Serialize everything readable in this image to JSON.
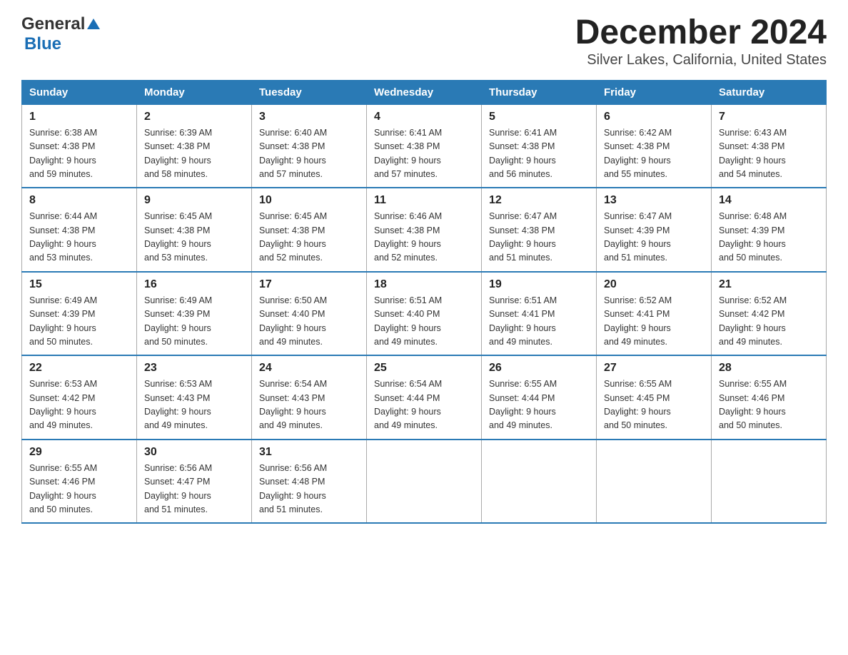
{
  "logo": {
    "general": "General",
    "blue": "Blue"
  },
  "title": "December 2024",
  "subtitle": "Silver Lakes, California, United States",
  "headers": [
    "Sunday",
    "Monday",
    "Tuesday",
    "Wednesday",
    "Thursday",
    "Friday",
    "Saturday"
  ],
  "weeks": [
    [
      {
        "day": "1",
        "sunrise": "6:38 AM",
        "sunset": "4:38 PM",
        "daylight": "9 hours and 59 minutes."
      },
      {
        "day": "2",
        "sunrise": "6:39 AM",
        "sunset": "4:38 PM",
        "daylight": "9 hours and 58 minutes."
      },
      {
        "day": "3",
        "sunrise": "6:40 AM",
        "sunset": "4:38 PM",
        "daylight": "9 hours and 57 minutes."
      },
      {
        "day": "4",
        "sunrise": "6:41 AM",
        "sunset": "4:38 PM",
        "daylight": "9 hours and 57 minutes."
      },
      {
        "day": "5",
        "sunrise": "6:41 AM",
        "sunset": "4:38 PM",
        "daylight": "9 hours and 56 minutes."
      },
      {
        "day": "6",
        "sunrise": "6:42 AM",
        "sunset": "4:38 PM",
        "daylight": "9 hours and 55 minutes."
      },
      {
        "day": "7",
        "sunrise": "6:43 AM",
        "sunset": "4:38 PM",
        "daylight": "9 hours and 54 minutes."
      }
    ],
    [
      {
        "day": "8",
        "sunrise": "6:44 AM",
        "sunset": "4:38 PM",
        "daylight": "9 hours and 53 minutes."
      },
      {
        "day": "9",
        "sunrise": "6:45 AM",
        "sunset": "4:38 PM",
        "daylight": "9 hours and 53 minutes."
      },
      {
        "day": "10",
        "sunrise": "6:45 AM",
        "sunset": "4:38 PM",
        "daylight": "9 hours and 52 minutes."
      },
      {
        "day": "11",
        "sunrise": "6:46 AM",
        "sunset": "4:38 PM",
        "daylight": "9 hours and 52 minutes."
      },
      {
        "day": "12",
        "sunrise": "6:47 AM",
        "sunset": "4:38 PM",
        "daylight": "9 hours and 51 minutes."
      },
      {
        "day": "13",
        "sunrise": "6:47 AM",
        "sunset": "4:39 PM",
        "daylight": "9 hours and 51 minutes."
      },
      {
        "day": "14",
        "sunrise": "6:48 AM",
        "sunset": "4:39 PM",
        "daylight": "9 hours and 50 minutes."
      }
    ],
    [
      {
        "day": "15",
        "sunrise": "6:49 AM",
        "sunset": "4:39 PM",
        "daylight": "9 hours and 50 minutes."
      },
      {
        "day": "16",
        "sunrise": "6:49 AM",
        "sunset": "4:39 PM",
        "daylight": "9 hours and 50 minutes."
      },
      {
        "day": "17",
        "sunrise": "6:50 AM",
        "sunset": "4:40 PM",
        "daylight": "9 hours and 49 minutes."
      },
      {
        "day": "18",
        "sunrise": "6:51 AM",
        "sunset": "4:40 PM",
        "daylight": "9 hours and 49 minutes."
      },
      {
        "day": "19",
        "sunrise": "6:51 AM",
        "sunset": "4:41 PM",
        "daylight": "9 hours and 49 minutes."
      },
      {
        "day": "20",
        "sunrise": "6:52 AM",
        "sunset": "4:41 PM",
        "daylight": "9 hours and 49 minutes."
      },
      {
        "day": "21",
        "sunrise": "6:52 AM",
        "sunset": "4:42 PM",
        "daylight": "9 hours and 49 minutes."
      }
    ],
    [
      {
        "day": "22",
        "sunrise": "6:53 AM",
        "sunset": "4:42 PM",
        "daylight": "9 hours and 49 minutes."
      },
      {
        "day": "23",
        "sunrise": "6:53 AM",
        "sunset": "4:43 PM",
        "daylight": "9 hours and 49 minutes."
      },
      {
        "day": "24",
        "sunrise": "6:54 AM",
        "sunset": "4:43 PM",
        "daylight": "9 hours and 49 minutes."
      },
      {
        "day": "25",
        "sunrise": "6:54 AM",
        "sunset": "4:44 PM",
        "daylight": "9 hours and 49 minutes."
      },
      {
        "day": "26",
        "sunrise": "6:55 AM",
        "sunset": "4:44 PM",
        "daylight": "9 hours and 49 minutes."
      },
      {
        "day": "27",
        "sunrise": "6:55 AM",
        "sunset": "4:45 PM",
        "daylight": "9 hours and 50 minutes."
      },
      {
        "day": "28",
        "sunrise": "6:55 AM",
        "sunset": "4:46 PM",
        "daylight": "9 hours and 50 minutes."
      }
    ],
    [
      {
        "day": "29",
        "sunrise": "6:55 AM",
        "sunset": "4:46 PM",
        "daylight": "9 hours and 50 minutes."
      },
      {
        "day": "30",
        "sunrise": "6:56 AM",
        "sunset": "4:47 PM",
        "daylight": "9 hours and 51 minutes."
      },
      {
        "day": "31",
        "sunrise": "6:56 AM",
        "sunset": "4:48 PM",
        "daylight": "9 hours and 51 minutes."
      },
      null,
      null,
      null,
      null
    ]
  ],
  "labels": {
    "sunrise": "Sunrise:",
    "sunset": "Sunset:",
    "daylight": "Daylight:"
  }
}
